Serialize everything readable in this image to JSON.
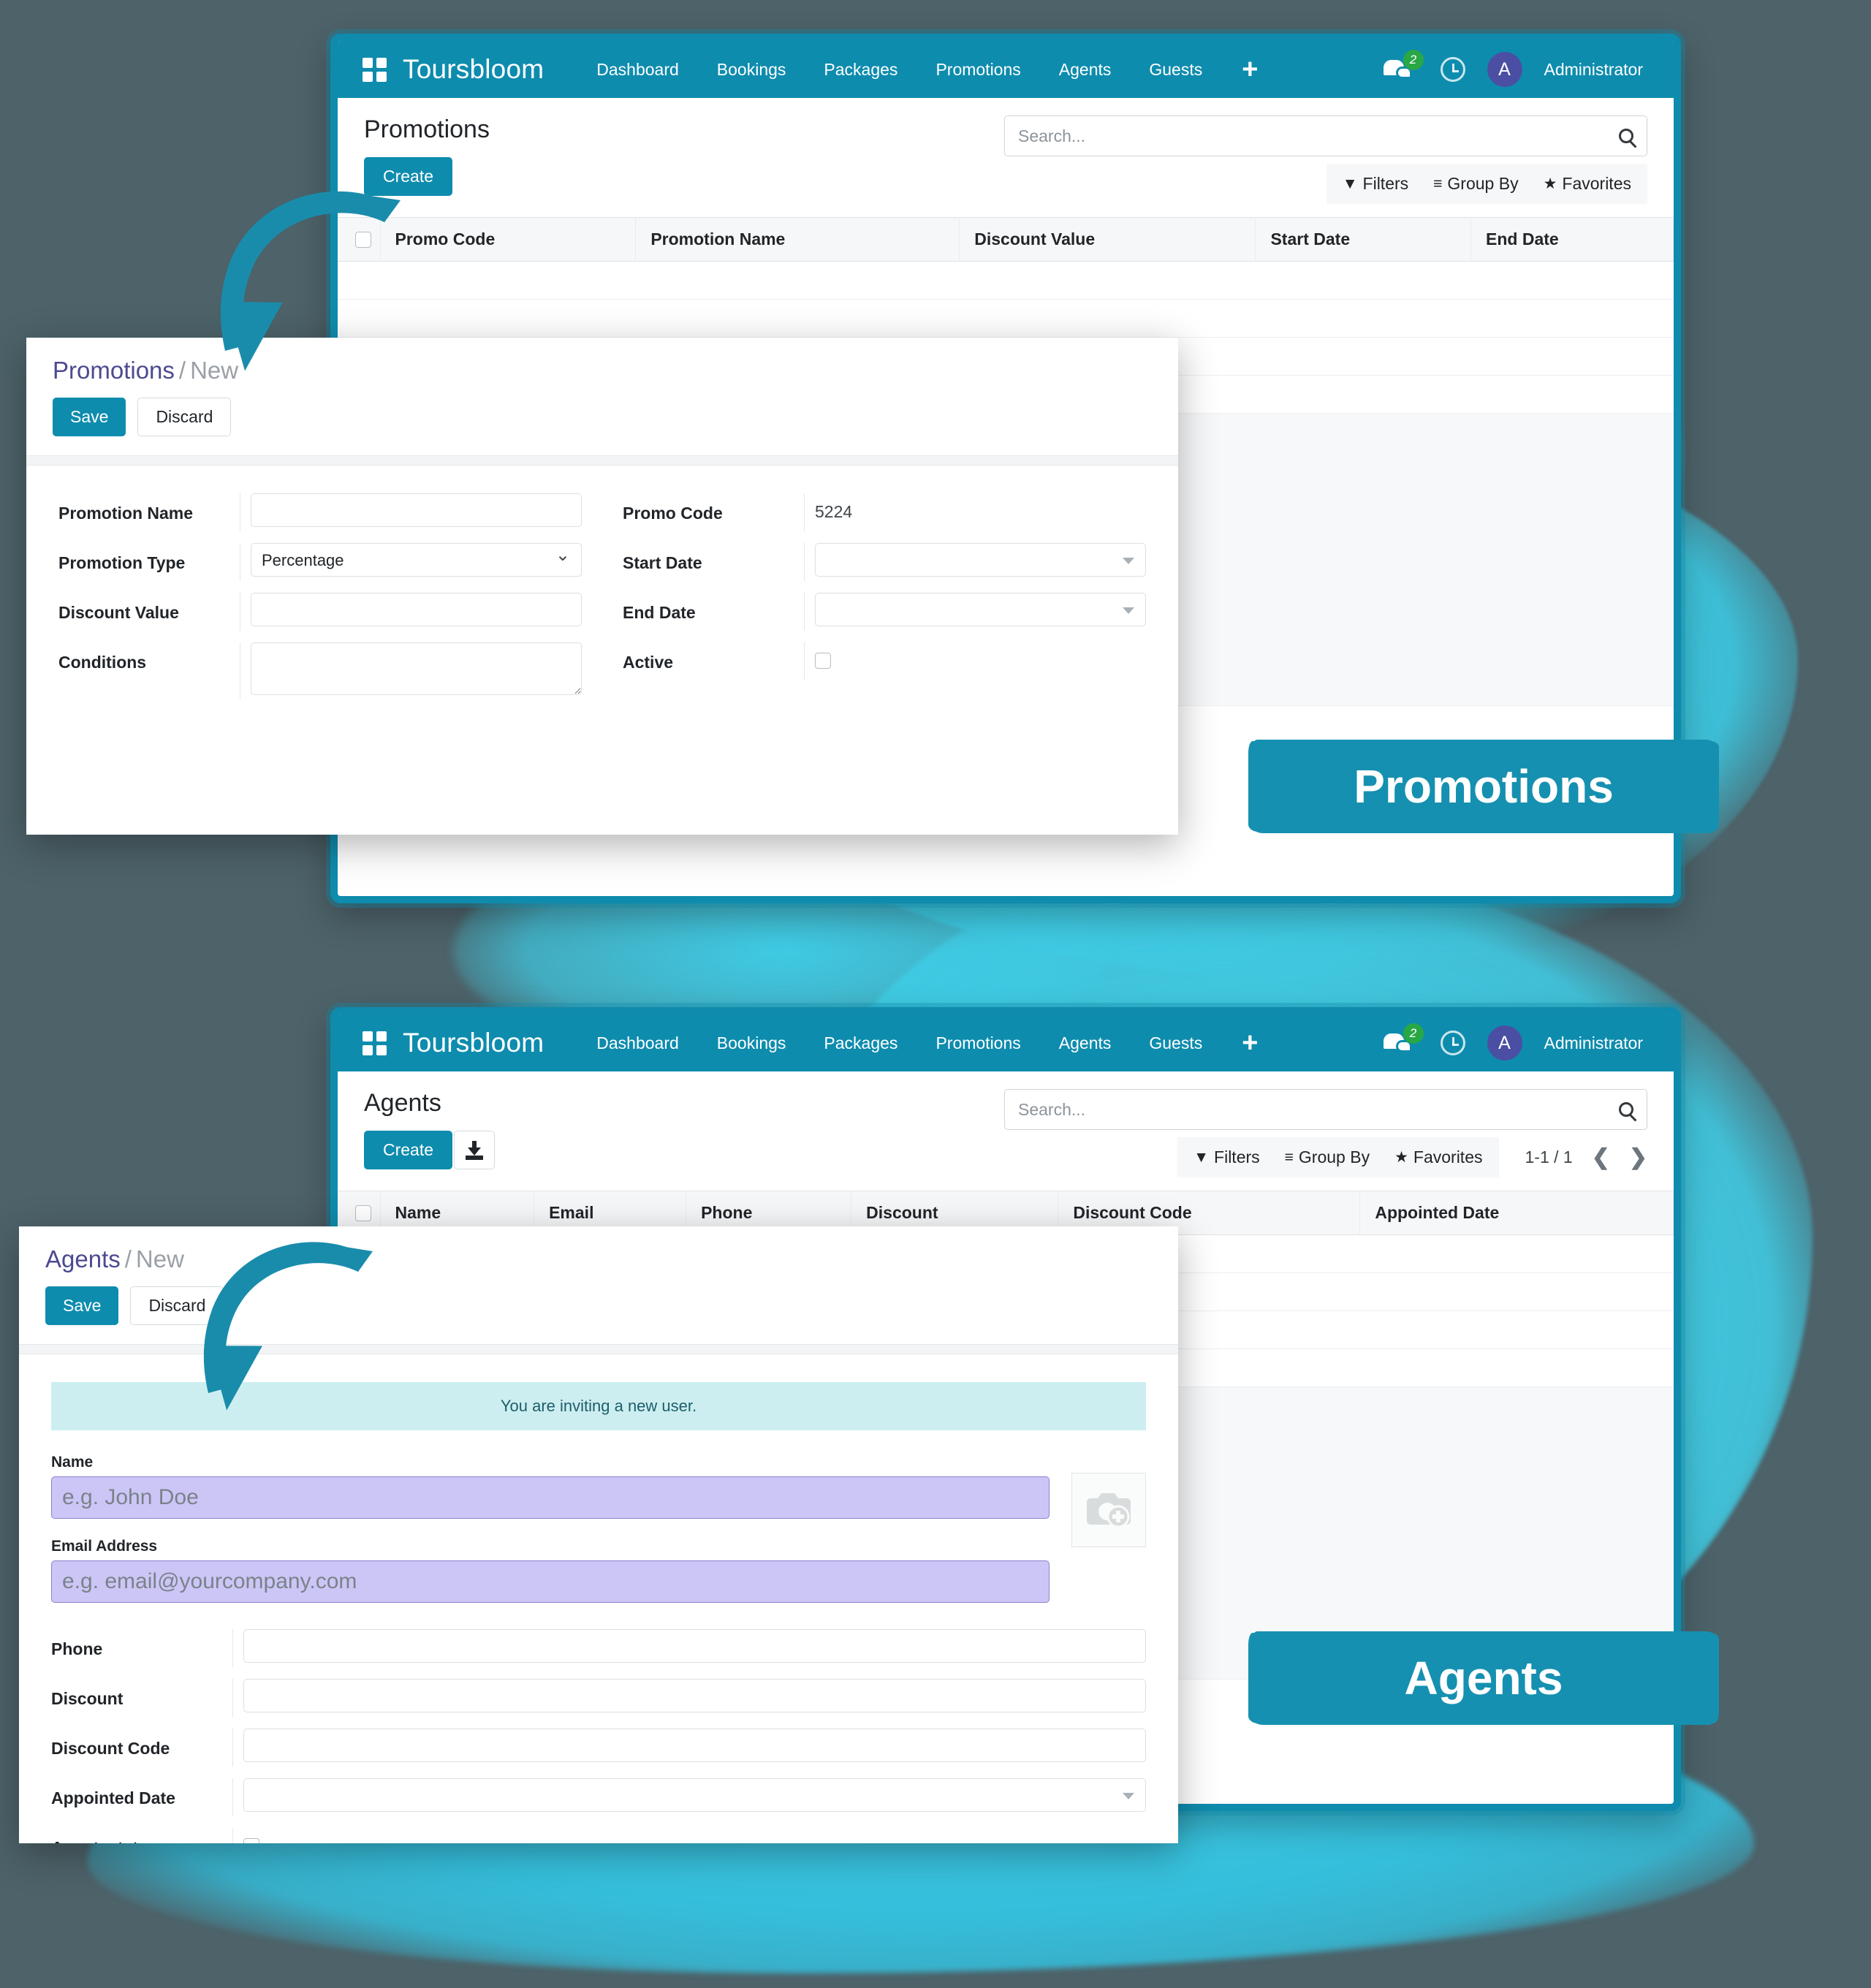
{
  "theme": {
    "brand_teal": "#0e8cae",
    "badge_teal": "#1690b0",
    "page_background": "#4d6269",
    "splash_cyan": "#3fcbe4",
    "avatar_purple": "#4a4fa3",
    "notification_green": "#28a745",
    "invite_banner_bg": "#cdeef0",
    "required_field_lavender": "#ccc6f7"
  },
  "navbar": {
    "apps_icon": "grid-apps-icon",
    "brand": "Toursbloom",
    "links": [
      "Dashboard",
      "Bookings",
      "Packages",
      "Promotions",
      "Agents",
      "Guests"
    ],
    "plus_label": "+",
    "messages_icon": "chat-bubbles-icon",
    "messages_count": "2",
    "activity_icon": "clock-icon",
    "avatar_initial": "A",
    "user_name": "Administrator"
  },
  "promotions_window": {
    "view_title": "Promotions",
    "create_label": "Create",
    "search": {
      "placeholder": "Search...",
      "value": "",
      "icon": "search-icon"
    },
    "tools": [
      {
        "label": "Filters",
        "icon": "filter-funnel-icon",
        "glyph": "▼"
      },
      {
        "label": "Group By",
        "icon": "hamburger-lines-icon",
        "glyph": "≡"
      },
      {
        "label": "Favorites",
        "icon": "star-icon",
        "glyph": "★"
      }
    ],
    "columns": [
      "Promo Code",
      "Promotion Name",
      "Discount Value",
      "Start Date",
      "End Date"
    ],
    "rows": []
  },
  "promotions_form": {
    "breadcrumb_root": "Promotions",
    "breadcrumb_sep": "/",
    "breadcrumb_current": "New",
    "save_label": "Save",
    "discard_label": "Discard",
    "left_fields": [
      {
        "label": "Promotion Name",
        "type": "text",
        "value": ""
      },
      {
        "label": "Promotion Type",
        "type": "select",
        "value": "Percentage",
        "options": [
          "Percentage"
        ]
      },
      {
        "label": "Discount Value",
        "type": "text",
        "value": ""
      },
      {
        "label": "Conditions",
        "type": "textarea",
        "value": ""
      }
    ],
    "right_fields": [
      {
        "label": "Promo Code",
        "type": "static",
        "value": "5224"
      },
      {
        "label": "Start Date",
        "type": "date",
        "value": ""
      },
      {
        "label": "End Date",
        "type": "date",
        "value": ""
      },
      {
        "label": "Active",
        "type": "checkbox",
        "value": ""
      }
    ]
  },
  "agents_window": {
    "view_title": "Agents",
    "create_label": "Create",
    "import_icon": "download-import-icon",
    "search": {
      "placeholder": "Search...",
      "value": "",
      "icon": "search-icon"
    },
    "tools": [
      {
        "label": "Filters",
        "icon": "filter-funnel-icon",
        "glyph": "▼"
      },
      {
        "label": "Group By",
        "icon": "hamburger-lines-icon",
        "glyph": "≡"
      },
      {
        "label": "Favorites",
        "icon": "star-icon",
        "glyph": "★"
      }
    ],
    "pager": {
      "count": "1-1 / 1",
      "prev_icon": "chevron-left-icon",
      "next_icon": "chevron-right-icon"
    },
    "columns": [
      "Name",
      "Email",
      "Phone",
      "Discount",
      "Discount Code",
      "Appointed Date"
    ],
    "rows": []
  },
  "agents_form": {
    "breadcrumb_root": "Agents",
    "breadcrumb_sep": "/",
    "breadcrumb_current": "New",
    "save_label": "Save",
    "discard_label": "Discard",
    "invite_notice": "You are inviting a new user.",
    "name_label": "Name",
    "name_placeholder": "e.g. John Doe",
    "name_value": "",
    "email_label": "Email Address",
    "email_placeholder": "e.g. email@yourcompany.com",
    "email_value": "",
    "photo_icon": "camera-add-photo-icon",
    "fields": [
      {
        "label": "Phone",
        "type": "text",
        "value": ""
      },
      {
        "label": "Discount",
        "type": "text",
        "value": ""
      },
      {
        "label": "Discount Code",
        "type": "text",
        "value": ""
      },
      {
        "label": "Appointed Date",
        "type": "date",
        "value": ""
      },
      {
        "label": "Agent_status",
        "type": "checkbox",
        "value": ""
      }
    ]
  },
  "badges": {
    "promotions": "Promotions",
    "agents": "Agents"
  },
  "annotations": {
    "arrow_promotions": "curved-arrow-icon",
    "arrow_agents": "curved-arrow-icon"
  }
}
